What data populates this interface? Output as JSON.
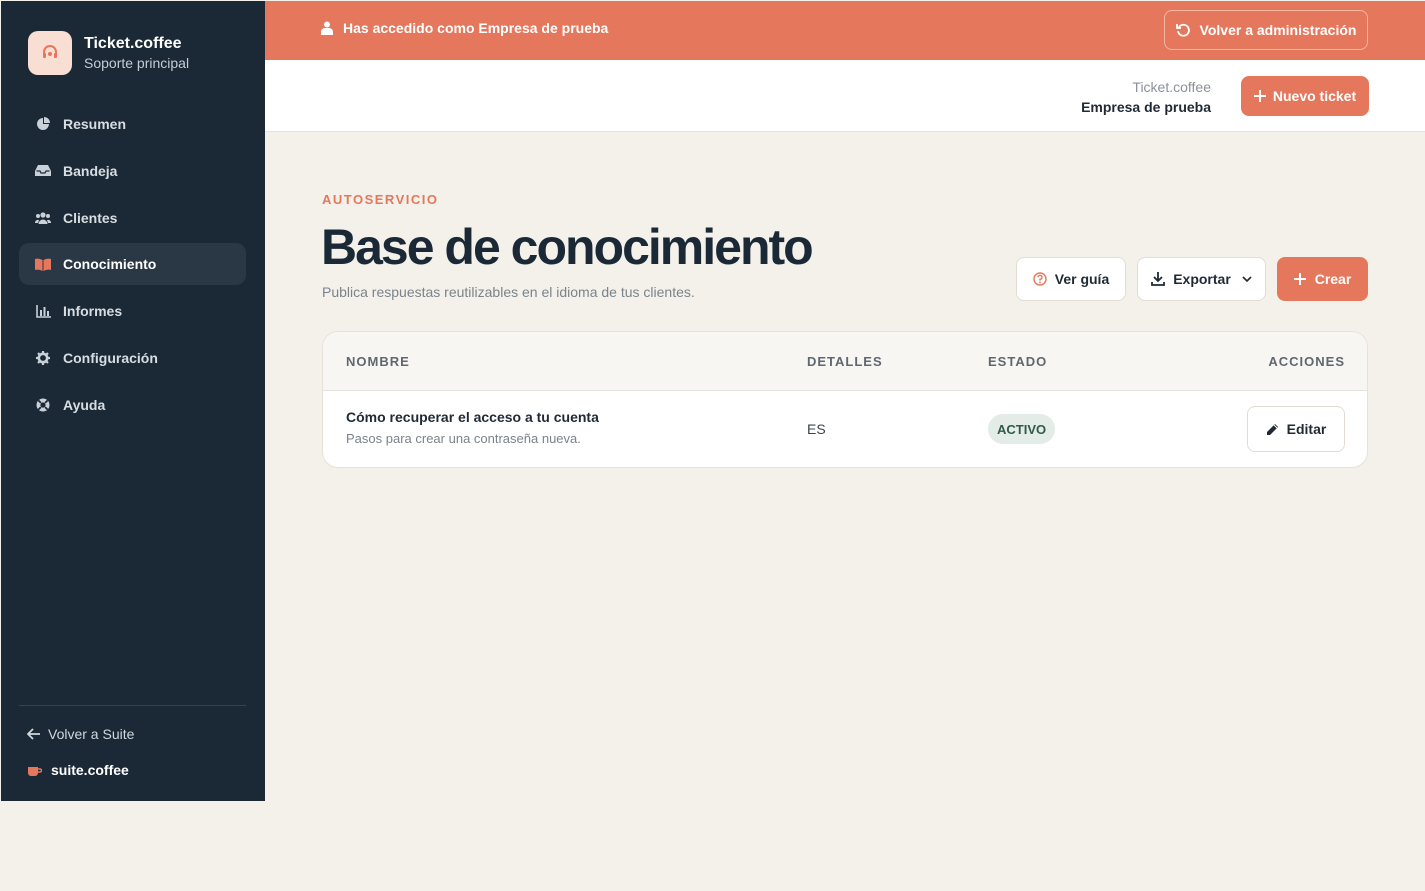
{
  "brand": {
    "name": "Ticket.coffee",
    "subtitle": "Soporte principal"
  },
  "sidebar": {
    "items": [
      {
        "label": "Resumen",
        "icon": "pie-chart-icon",
        "active": false
      },
      {
        "label": "Bandeja",
        "icon": "inbox-icon",
        "active": false
      },
      {
        "label": "Clientes",
        "icon": "users-icon",
        "active": false
      },
      {
        "label": "Conocimiento",
        "icon": "book-icon",
        "active": true
      },
      {
        "label": "Informes",
        "icon": "bar-chart-icon",
        "active": false
      },
      {
        "label": "Configuración",
        "icon": "gear-icon",
        "active": false
      },
      {
        "label": "Ayuda",
        "icon": "lifebuoy-icon",
        "active": false
      }
    ],
    "back_label": "Volver a Suite",
    "suite_label": "suite.coffee"
  },
  "banner": {
    "text": "Has accedido como Empresa de prueba",
    "button_label": "Volver a administración"
  },
  "topbar": {
    "app_name": "Ticket.coffee",
    "company": "Empresa de prueba",
    "new_ticket_label": "Nuevo ticket"
  },
  "page": {
    "eyebrow": "AUTOSERVICIO",
    "title": "Base de conocimiento",
    "description": "Publica respuestas reutilizables en el idioma de tus clientes.",
    "guide_label": "Ver guía",
    "export_label": "Exportar",
    "create_label": "Crear"
  },
  "table": {
    "headers": {
      "name": "NOMBRE",
      "details": "DETALLES",
      "status": "ESTADO",
      "actions": "ACCIONES"
    },
    "rows": [
      {
        "title": "Cómo recuperar el acceso a tu cuenta",
        "subtitle": "Pasos para crear una contraseña nueva.",
        "language": "ES",
        "status": "ACTIVO",
        "action_label": "Editar"
      }
    ]
  },
  "colors": {
    "accent": "#e5775c",
    "sidebar": "#1b2937",
    "background": "#f4f1eb",
    "status_active_bg": "#e3ece6"
  }
}
